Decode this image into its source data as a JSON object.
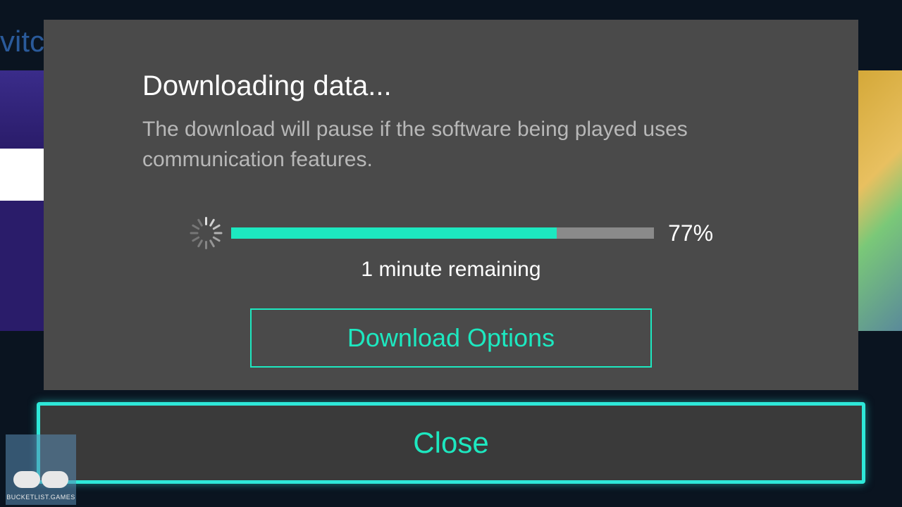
{
  "background": {
    "left_text": "vitc"
  },
  "dialog": {
    "title": "Downloading data...",
    "subtitle": "The download will pause if the software being played uses communication features.",
    "progress_percent": 77,
    "progress_label": "77%",
    "time_remaining": "1 minute remaining",
    "download_options_label": "Download Options",
    "close_label": "Close"
  },
  "watermark": {
    "text": "BUCKETLIST.GAMES"
  },
  "colors": {
    "accent": "#1de8c0",
    "dialog_bg": "#4a4a4a",
    "page_bg": "#0a1420"
  }
}
